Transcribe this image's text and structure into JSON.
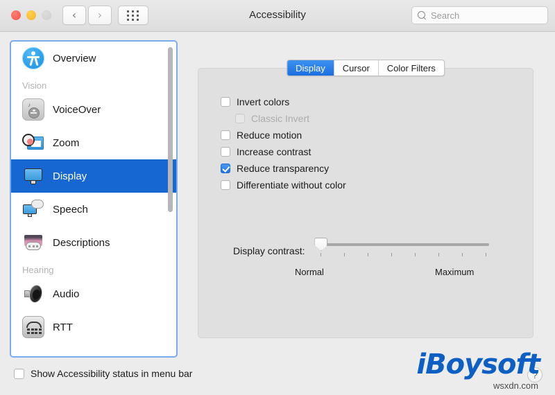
{
  "window": {
    "title": "Accessibility",
    "traffic_lights": [
      "close",
      "minimize",
      "zoom"
    ],
    "nav": {
      "back": "‹",
      "forward": "›",
      "grid": "grid-icon"
    },
    "search": {
      "placeholder": "Search",
      "value": ""
    }
  },
  "sidebar": {
    "items": [
      {
        "label": "Overview",
        "icon": "accessibility-person-icon",
        "selected": false,
        "type": "item"
      },
      {
        "label": "Vision",
        "type": "group"
      },
      {
        "label": "VoiceOver",
        "icon": "voiceover-icon",
        "selected": false,
        "type": "item"
      },
      {
        "label": "Zoom",
        "icon": "zoom-magnifier-icon",
        "selected": false,
        "type": "item"
      },
      {
        "label": "Display",
        "icon": "display-monitor-icon",
        "selected": true,
        "type": "item"
      },
      {
        "label": "Speech",
        "icon": "speech-bubble-icon",
        "selected": false,
        "type": "item"
      },
      {
        "label": "Descriptions",
        "icon": "descriptions-icon",
        "selected": false,
        "type": "item"
      },
      {
        "label": "Hearing",
        "type": "group"
      },
      {
        "label": "Audio",
        "icon": "speaker-icon",
        "selected": false,
        "type": "item"
      },
      {
        "label": "RTT",
        "icon": "telephone-icon",
        "selected": false,
        "type": "item"
      }
    ],
    "scrollbar": {
      "position": "top"
    }
  },
  "pane": {
    "tabs": [
      {
        "label": "Display",
        "active": true
      },
      {
        "label": "Cursor",
        "active": false
      },
      {
        "label": "Color Filters",
        "active": false
      }
    ],
    "checkboxes": [
      {
        "label": "Invert colors",
        "checked": false,
        "disabled": false,
        "indented": false
      },
      {
        "label": "Classic Invert",
        "checked": false,
        "disabled": true,
        "indented": true
      },
      {
        "label": "Reduce motion",
        "checked": false,
        "disabled": false,
        "indented": false
      },
      {
        "label": "Increase contrast",
        "checked": false,
        "disabled": false,
        "indented": false
      },
      {
        "label": "Reduce transparency",
        "checked": true,
        "disabled": false,
        "indented": false
      },
      {
        "label": "Differentiate without color",
        "checked": false,
        "disabled": false,
        "indented": false
      }
    ],
    "slider": {
      "label": "Display contrast:",
      "min_label": "Normal",
      "max_label": "Maximum",
      "value": 0,
      "min": 0,
      "max": 100,
      "ticks": 8
    }
  },
  "footer": {
    "checkbox": {
      "label": "Show Accessibility status in menu bar",
      "checked": false
    },
    "help": "?"
  },
  "watermark": {
    "logo": "iBoysoft",
    "url": "wsxdn.com"
  },
  "colors": {
    "accent_blue": "#1767d2",
    "tab_blue": "#2f86ee",
    "focus_ring": "#7aaaf0",
    "window_bg": "#ececec",
    "panel_bg": "#e0e0e0",
    "watermark_blue": "#0d5fc4"
  }
}
